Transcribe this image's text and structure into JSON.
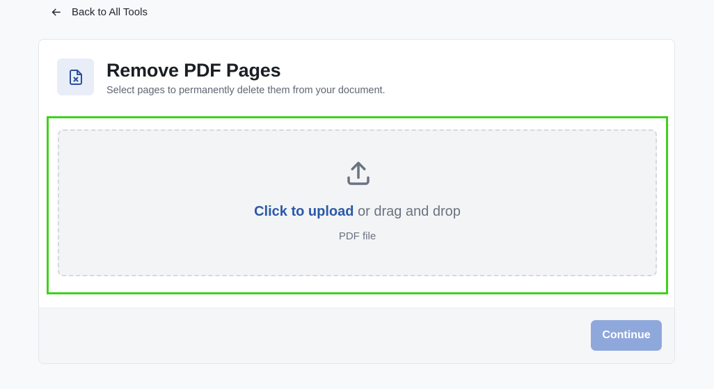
{
  "nav": {
    "back_label": "Back to All Tools",
    "back_icon": "arrow-left-icon"
  },
  "tool": {
    "icon": "file-x-icon",
    "title": "Remove PDF Pages",
    "subtitle": "Select pages to permanently delete them from your document."
  },
  "upload": {
    "icon": "upload-icon",
    "link_text": "Click to upload",
    "rest_text": " or drag and drop",
    "hint": "PDF file"
  },
  "footer": {
    "continue_label": "Continue",
    "continue_disabled": true
  },
  "colors": {
    "accent": "#2b58a8",
    "button_disabled": "#8fa8dc",
    "highlight": "#3fd11b"
  }
}
